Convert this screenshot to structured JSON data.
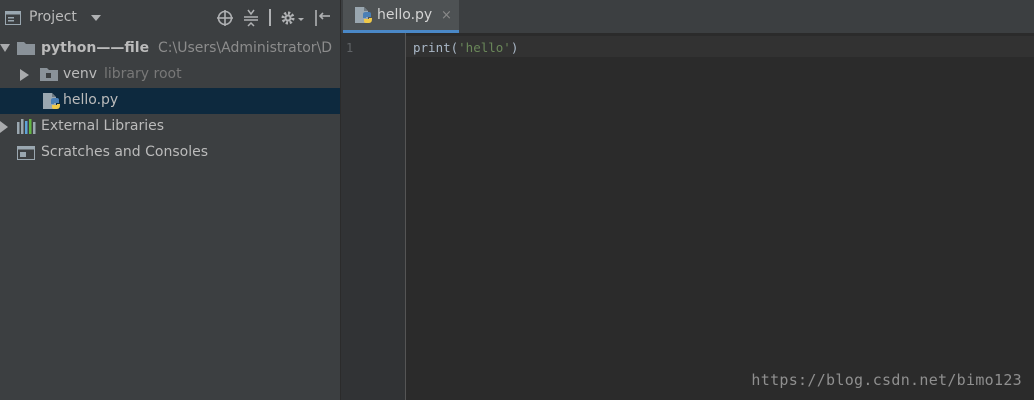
{
  "project_panel": {
    "title": "Project",
    "icons": [
      "project-view-icon",
      "dropdown-arrow-icon",
      "locate-icon",
      "collapse-all-icon",
      "gear-icon",
      "hide-panel-icon"
    ]
  },
  "tree": {
    "root": {
      "name": "python——file",
      "path": "C:\\Users\\Administrator\\D"
    },
    "venv": {
      "name": "venv",
      "hint": "library root"
    },
    "hello": {
      "name": "hello.py"
    },
    "external": {
      "name": "External Libraries"
    },
    "scratches": {
      "name": "Scratches and Consoles"
    }
  },
  "editor": {
    "tab_label": "hello.py",
    "tab_close": "×",
    "line_number": "1",
    "code": {
      "prefix": "print(",
      "string": "'hello'",
      "suffix": ")"
    }
  },
  "watermark": "https://blog.csdn.net/bimo123",
  "colors": {
    "panel_bg": "#3c3f41",
    "editor_bg": "#2b2b2b",
    "selection": "#0d293e",
    "tab_underline": "#4a88c7",
    "string": "#6a8759"
  }
}
